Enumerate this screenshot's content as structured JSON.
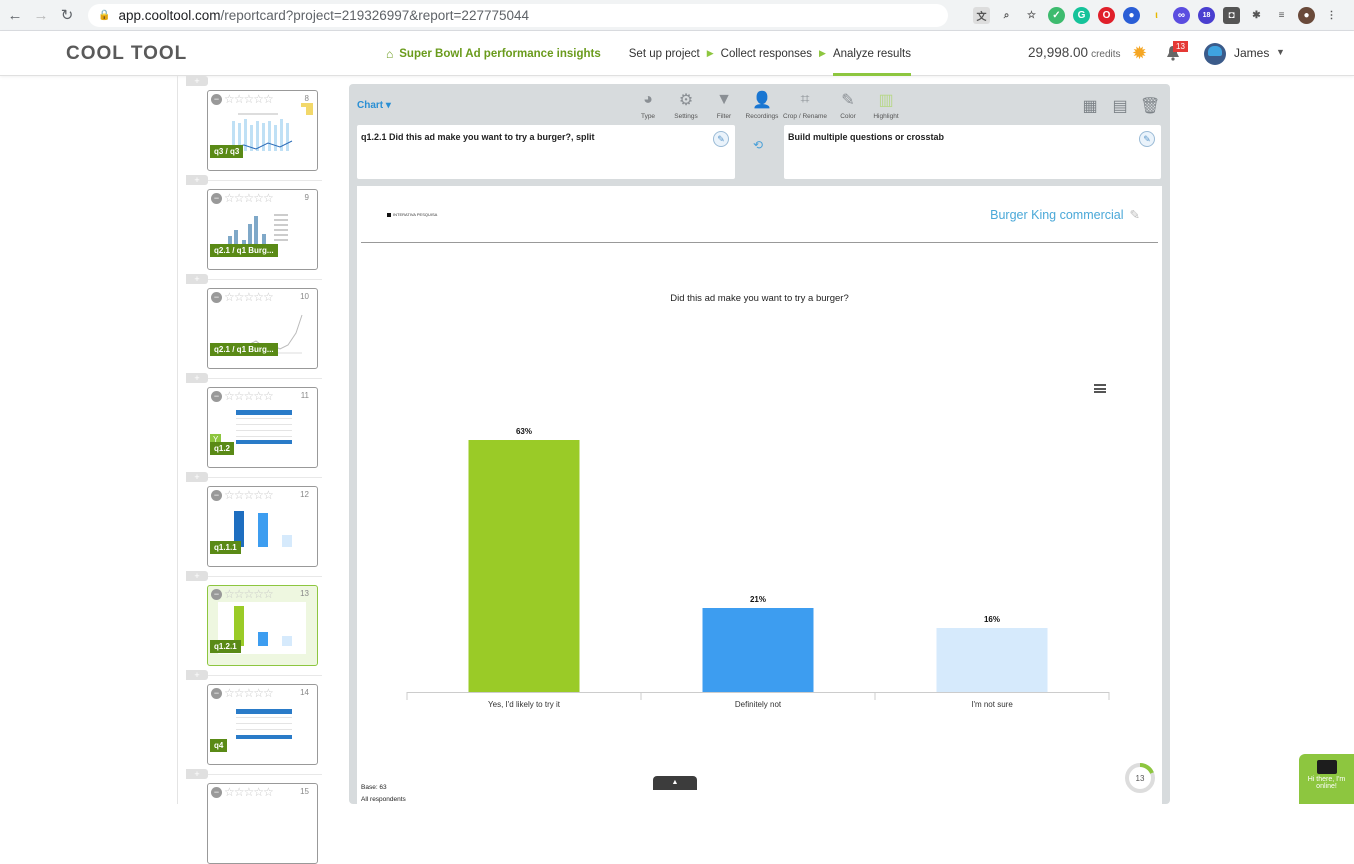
{
  "browser": {
    "url_host": "app.cooltool.com",
    "url_path": "/reportcard?project=219326997&report=227775044",
    "ext_badge": "18"
  },
  "header": {
    "logo": "COOL TOOL",
    "project_name": "Super Bowl Ad performance insights",
    "steps": [
      "Set up project",
      "Collect responses",
      "Analyze results"
    ],
    "credits_value": "29,998.00",
    "credits_label": "credits",
    "notifications_count": "13",
    "user_name": "James"
  },
  "sidebar": {
    "slides": [
      {
        "number": "8",
        "tag": "q3 / q3"
      },
      {
        "number": "9",
        "tag": "q2.1 / q1 Burg..."
      },
      {
        "number": "10",
        "tag": "q2.1 / q1 Burg..."
      },
      {
        "number": "11",
        "tag": "q1.2",
        "filter": "Y"
      },
      {
        "number": "12",
        "tag": "q1.1.1"
      },
      {
        "number": "13",
        "tag": "q1.2.1"
      },
      {
        "number": "14",
        "tag": "q4"
      },
      {
        "number": "15",
        "tag": ""
      }
    ],
    "stars": "☆☆☆☆☆"
  },
  "toolbar": {
    "chart_label": "Chart",
    "tools": [
      "Type",
      "Settings",
      "Filter",
      "Recordings",
      "Crop / Rename",
      "Color",
      "Highlight"
    ]
  },
  "question_box": {
    "text": "q1.2.1 Did this ad make you want to try a burger?, split"
  },
  "crosstab_box": {
    "text": "Build multiple questions or crosstab"
  },
  "report": {
    "brand": "INTERATIVA PESQUISA",
    "title": "Burger King commercial",
    "base": "Base: 63",
    "respondents": "All respondents",
    "progress_count": "13"
  },
  "chat": {
    "text": "Hi there, I'm online!"
  },
  "chart_data": {
    "type": "bar",
    "title": "Did this ad make you want to try a burger?",
    "categories": [
      "Yes, I'd likely to try it",
      "Definitely not",
      "I'm not sure"
    ],
    "values": [
      63,
      21,
      16
    ],
    "value_labels": [
      "63%",
      "21%",
      "16%"
    ],
    "colors": [
      "#9acb27",
      "#3d9df0",
      "#d6eafc"
    ],
    "ylim": [
      0,
      70
    ],
    "grid": false
  }
}
